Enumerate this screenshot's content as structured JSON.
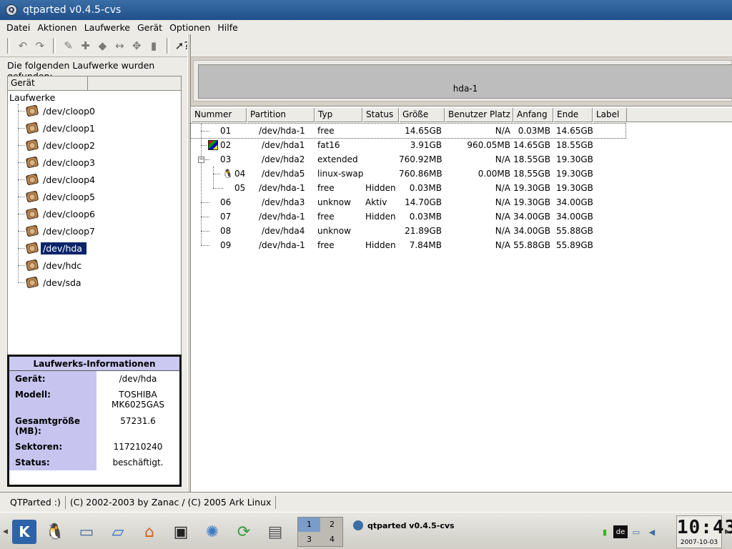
{
  "window": {
    "title": "qtparted v0.4.5-cvs"
  },
  "menu": [
    {
      "label": "Datei"
    },
    {
      "label": "Aktionen"
    },
    {
      "label": "Laufwerke"
    },
    {
      "label": "Gerät"
    },
    {
      "label": "Optionen"
    },
    {
      "label": "Hilfe"
    }
  ],
  "toolbar": {
    "icons": [
      "undo-icon",
      "redo-icon",
      "properties-wrench-icon",
      "create-partition-icon",
      "format-eraser-icon",
      "resize-icon",
      "move-icon",
      "delete-trash-icon",
      "whats-this-help-icon"
    ]
  },
  "left": {
    "found_label": "Die folgenden Laufwerke wurden gefunden:",
    "tree_header": "Gerät",
    "tree_root": "Laufwerke",
    "devices": [
      "/dev/cloop0",
      "/dev/cloop1",
      "/dev/cloop2",
      "/dev/cloop3",
      "/dev/cloop4",
      "/dev/cloop5",
      "/dev/cloop6",
      "/dev/cloop7",
      "/dev/hda",
      "/dev/hdc",
      "/dev/sda"
    ],
    "selected_device": "/dev/hda"
  },
  "info": {
    "title": "Laufwerks-Informationen",
    "rows": [
      {
        "key": "Gerät:",
        "value": "/dev/hda"
      },
      {
        "key": "Modell:",
        "value": "TOSHIBA MK6025GAS"
      },
      {
        "key": "Gesamtgröße (MB):",
        "value": "57231.6"
      },
      {
        "key": "Sektoren:",
        "value": "117210240"
      },
      {
        "key": "Status:",
        "value": "beschäftigt."
      }
    ]
  },
  "diskmap": {
    "label": "hda-1"
  },
  "table": {
    "headers": [
      "Nummer",
      "Partition",
      "Typ",
      "Status",
      "Größe",
      "Benutzer Platz",
      "Anfang",
      "Ende",
      "Label"
    ],
    "rows": [
      {
        "num": "01",
        "partition": "/dev/hda-1",
        "type": "free",
        "status": "",
        "size": "14.65GB",
        "used": "N/A",
        "start": "0.03MB",
        "end": "14.65GB",
        "label": ""
      },
      {
        "num": "02",
        "partition": "/dev/hda1",
        "type": "fat16",
        "status": "",
        "size": "3.91GB",
        "used": "960.05MB",
        "start": "14.65GB",
        "end": "18.55GB",
        "label": ""
      },
      {
        "num": "03",
        "partition": "/dev/hda2",
        "type": "extended",
        "status": "",
        "size": "760.92MB",
        "used": "N/A",
        "start": "18.55GB",
        "end": "19.30GB",
        "label": ""
      },
      {
        "num": "04",
        "partition": "/dev/hda5",
        "type": "linux-swap",
        "status": "",
        "size": "760.86MB",
        "used": "0.00MB",
        "start": "18.55GB",
        "end": "19.30GB",
        "label": ""
      },
      {
        "num": "05",
        "partition": "/dev/hda-1",
        "type": "free",
        "status": "Hidden",
        "size": "0.03MB",
        "used": "N/A",
        "start": "19.30GB",
        "end": "19.30GB",
        "label": ""
      },
      {
        "num": "06",
        "partition": "/dev/hda3",
        "type": "unknow",
        "status": "Aktiv",
        "size": "14.70GB",
        "used": "N/A",
        "start": "19.30GB",
        "end": "34.00GB",
        "label": ""
      },
      {
        "num": "07",
        "partition": "/dev/hda-1",
        "type": "free",
        "status": "Hidden",
        "size": "0.03MB",
        "used": "N/A",
        "start": "34.00GB",
        "end": "34.00GB",
        "label": ""
      },
      {
        "num": "08",
        "partition": "/dev/hda4",
        "type": "unknow",
        "status": "",
        "size": "21.89GB",
        "used": "N/A",
        "start": "34.00GB",
        "end": "55.88GB",
        "label": ""
      },
      {
        "num": "09",
        "partition": "/dev/hda-1",
        "type": "free",
        "status": "Hidden",
        "size": "7.84MB",
        "used": "N/A",
        "start": "55.88GB",
        "end": "55.89GB",
        "label": ""
      }
    ]
  },
  "statusbar": {
    "left": "QTParted :)",
    "right": "(C) 2002-2003 by Zanac / (C) 2005 Ark Linux"
  },
  "taskbar": {
    "pager": [
      "1",
      "2",
      "3",
      "4"
    ],
    "task_label": "qtparted v0.4.5-cvs",
    "tray_lang": "de",
    "clock_time": "10:43",
    "clock_date": "2007-10-03"
  }
}
